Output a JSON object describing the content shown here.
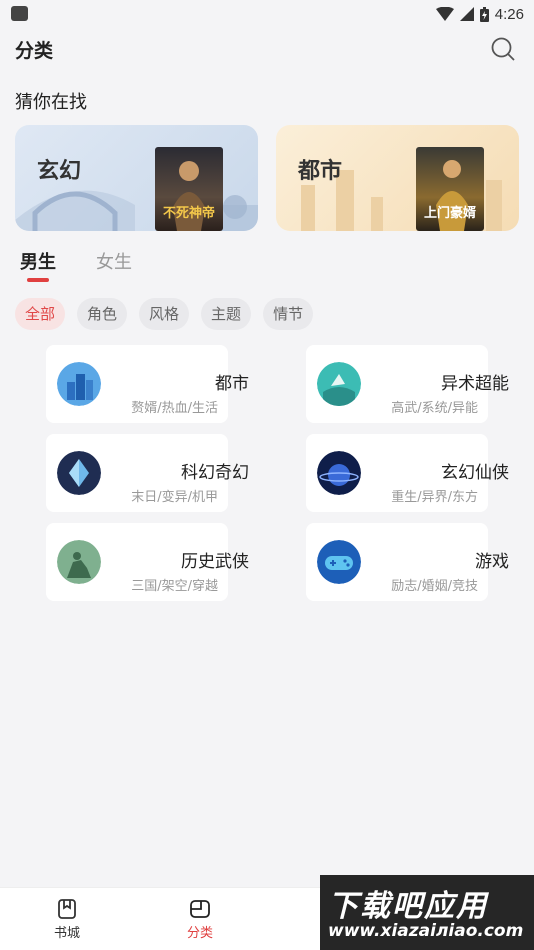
{
  "statusbar": {
    "app_icon": "hms-icon",
    "time": "4:26",
    "icons": [
      "wifi-icon",
      "signal-icon",
      "battery-icon"
    ]
  },
  "header": {
    "title": "分类",
    "search_icon": "search-icon"
  },
  "guess": {
    "title": "猜你在找",
    "banners": [
      {
        "label": "玄幻",
        "book_title": "不死神帝"
      },
      {
        "label": "都市",
        "book_title": "上门豪婿"
      }
    ]
  },
  "gender_tabs": {
    "male": "男生",
    "female": "女生",
    "active": "male"
  },
  "chips": [
    "全部",
    "角色",
    "风格",
    "主题",
    "情节"
  ],
  "active_chip": "全部",
  "categories": [
    {
      "name": "都市",
      "tags": "赘婿/热血/生活",
      "icon": "city-buildings-icon"
    },
    {
      "name": "异术超能",
      "tags": "高武/系统/异能",
      "icon": "supernatural-icon"
    },
    {
      "name": "科幻奇幻",
      "tags": "末日/变异/机甲",
      "icon": "crystal-icon"
    },
    {
      "name": "玄幻仙侠",
      "tags": "重生/异界/东方",
      "icon": "fantasy-planet-icon"
    },
    {
      "name": "历史武侠",
      "tags": "三国/架空/穿越",
      "icon": "soldier-icon"
    },
    {
      "name": "游戏",
      "tags": "励志/婚姻/竞技",
      "icon": "gamepad-icon"
    }
  ],
  "bottom_nav": [
    {
      "label": "书城",
      "icon": "bookstore-icon"
    },
    {
      "label": "分类",
      "icon": "category-icon"
    }
  ],
  "watermark": {
    "line1": "下载吧应用",
    "line2": "www.xiazaiлiao.com"
  },
  "colors": {
    "accent": "#e04040",
    "background": "#f4f4f6"
  }
}
